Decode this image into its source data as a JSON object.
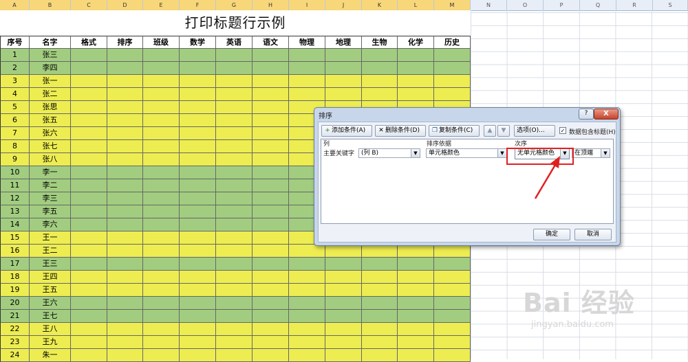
{
  "columns": [
    "A",
    "B",
    "C",
    "D",
    "E",
    "F",
    "G",
    "H",
    "I",
    "J",
    "K",
    "L",
    "M",
    "N",
    "O",
    "P",
    "Q",
    "R",
    "S"
  ],
  "sheet_title": "打印标题行示例",
  "table_headers": [
    "序号",
    "名字",
    "格式",
    "排序",
    "班级",
    "数学",
    "英语",
    "语文",
    "物理",
    "地理",
    "生物",
    "化学",
    "历史"
  ],
  "rows": [
    {
      "no": "1",
      "name": "张三",
      "color": "green"
    },
    {
      "no": "2",
      "name": "李四",
      "color": "green"
    },
    {
      "no": "3",
      "name": "张一",
      "color": "yellow"
    },
    {
      "no": "4",
      "name": "张二",
      "color": "yellow"
    },
    {
      "no": "5",
      "name": "张思",
      "color": "yellow"
    },
    {
      "no": "6",
      "name": "张五",
      "color": "yellow"
    },
    {
      "no": "7",
      "name": "张六",
      "color": "yellow"
    },
    {
      "no": "8",
      "name": "张七",
      "color": "yellow"
    },
    {
      "no": "9",
      "name": "张八",
      "color": "yellow"
    },
    {
      "no": "10",
      "name": "李一",
      "color": "green"
    },
    {
      "no": "11",
      "name": "李二",
      "color": "green"
    },
    {
      "no": "12",
      "name": "李三",
      "color": "green"
    },
    {
      "no": "13",
      "name": "李五",
      "color": "green"
    },
    {
      "no": "14",
      "name": "李六",
      "color": "green"
    },
    {
      "no": "15",
      "name": "王一",
      "color": "yellow"
    },
    {
      "no": "16",
      "name": "王二",
      "color": "yellow"
    },
    {
      "no": "17",
      "name": "王三",
      "color": "green"
    },
    {
      "no": "18",
      "name": "王四",
      "color": "yellow"
    },
    {
      "no": "19",
      "name": "王五",
      "color": "yellow"
    },
    {
      "no": "20",
      "name": "王六",
      "color": "green"
    },
    {
      "no": "21",
      "name": "王七",
      "color": "green"
    },
    {
      "no": "22",
      "name": "王八",
      "color": "yellow"
    },
    {
      "no": "23",
      "name": "王九",
      "color": "yellow"
    },
    {
      "no": "24",
      "name": "朱一",
      "color": "yellow"
    }
  ],
  "colors": {
    "green": "#a2cd80",
    "yellow": "#eded52",
    "highlight": "#e02020"
  },
  "dialog": {
    "title": "排序",
    "help": "?",
    "close": "X",
    "add_condition": "添加条件(A)",
    "delete_condition": "删除条件(D)",
    "copy_condition": "复制条件(C)",
    "move_up_icon": "arrow-up-icon",
    "move_down_icon": "arrow-down-icon",
    "options": "选项(O)...",
    "has_header": "数据包含标题(H)",
    "has_header_checked": true,
    "col_header": "列",
    "sort_on_header": "排序依据",
    "order_header": "次序",
    "primary_key_label": "主要关键字",
    "column_value": "(列 B)",
    "sort_on_value": "单元格颜色",
    "order_value": "无单元格颜色",
    "position_value": "在顶端",
    "ok": "确定",
    "cancel": "取消"
  },
  "watermark": {
    "main": "Bai 经验",
    "sub": "jingyan.baidu.com"
  }
}
